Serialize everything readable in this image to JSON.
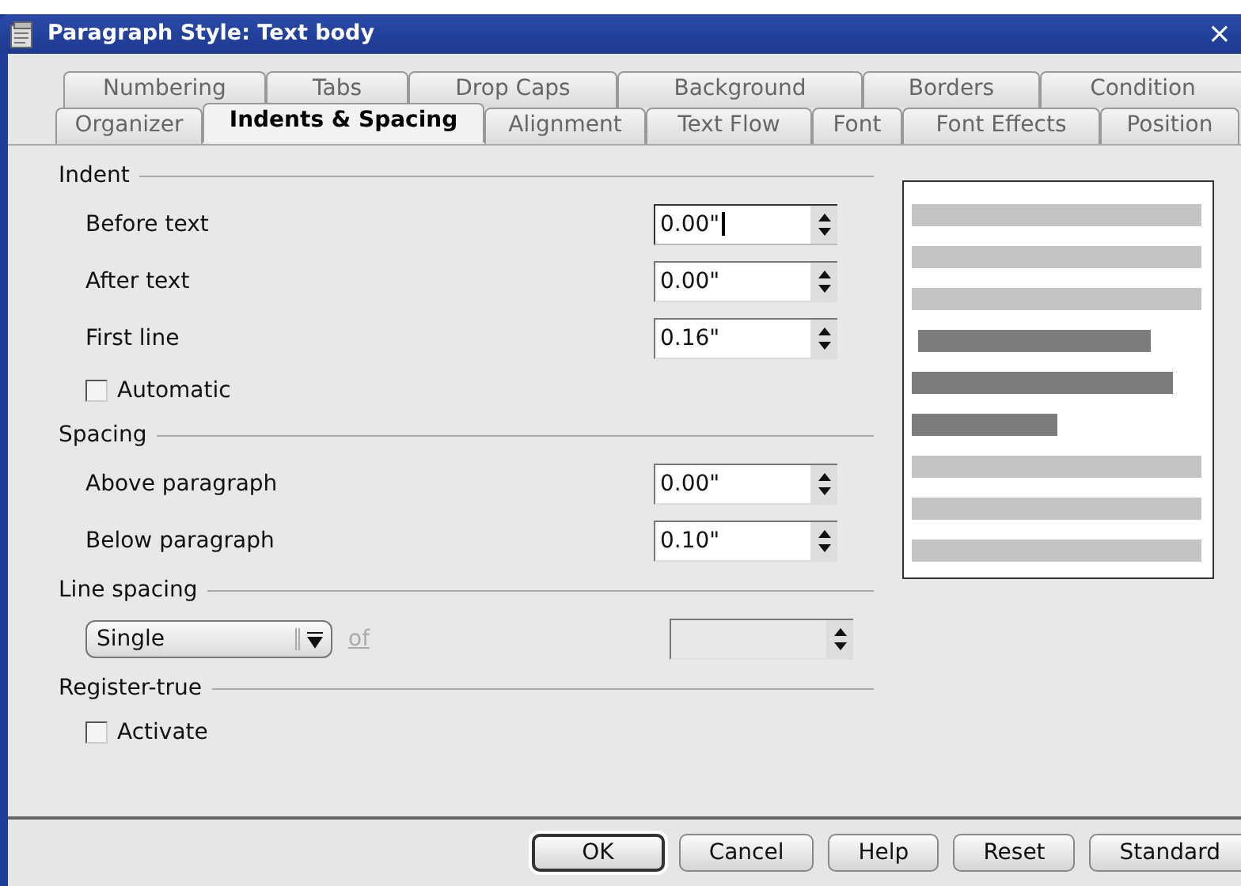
{
  "window": {
    "title": "Paragraph Style: Text body",
    "close": "×"
  },
  "tab_rows": [
    [
      {
        "label": "Numbering",
        "selected": false
      },
      {
        "label": "Tabs",
        "selected": false
      },
      {
        "label": "Drop Caps",
        "selected": false
      },
      {
        "label": "Background",
        "selected": false
      },
      {
        "label": "Borders",
        "selected": false
      },
      {
        "label": "Condition",
        "selected": false
      }
    ],
    [
      {
        "label": "Organizer",
        "selected": false
      },
      {
        "label": "Indents & Spacing",
        "selected": true
      },
      {
        "label": "Alignment",
        "selected": false
      },
      {
        "label": "Text Flow",
        "selected": false
      },
      {
        "label": "Font",
        "selected": false
      },
      {
        "label": "Font Effects",
        "selected": false
      },
      {
        "label": "Position",
        "selected": false
      }
    ]
  ],
  "groups": [
    {
      "title": "Indent",
      "rows": [
        {
          "kind": "spin",
          "label": "Before text",
          "value": "0.00\"",
          "focused": true
        },
        {
          "kind": "spin",
          "label": "After text",
          "value": "0.00\"",
          "focused": false
        },
        {
          "kind": "spin",
          "label": "First line",
          "value": "0.16\"",
          "focused": false
        },
        {
          "kind": "checkbox",
          "label": "Automatic",
          "checked": false
        }
      ]
    },
    {
      "title": "Spacing",
      "rows": [
        {
          "kind": "spin",
          "label": "Above paragraph",
          "value": "0.00\"",
          "focused": false
        },
        {
          "kind": "spin",
          "label": "Below paragraph",
          "value": "0.10\"",
          "focused": false
        }
      ]
    },
    {
      "title": "Line spacing",
      "rows": [
        {
          "kind": "select",
          "value": "Single",
          "of_label": "of",
          "of_disabled": true
        }
      ]
    },
    {
      "title": "Register-true",
      "rows": [
        {
          "kind": "checkbox",
          "label": "Activate",
          "checked": false
        }
      ]
    }
  ],
  "buttons": [
    {
      "label": "OK",
      "default": true
    },
    {
      "label": "Cancel",
      "default": false
    },
    {
      "label": "Help",
      "default": false
    },
    {
      "label": "Reset",
      "default": false
    },
    {
      "label": "Standard",
      "default": false
    }
  ]
}
